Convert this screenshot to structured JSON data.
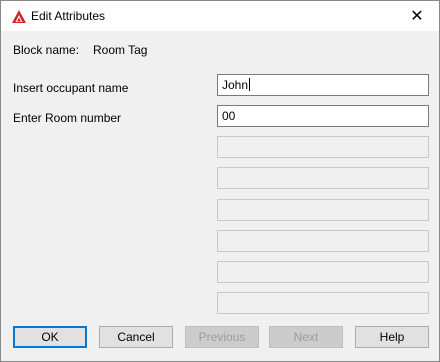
{
  "window": {
    "title": "Edit Attributes"
  },
  "block": {
    "label": "Block name:",
    "value": "Room Tag"
  },
  "attributes": [
    {
      "prompt": "Insert occupant name",
      "value": "John"
    },
    {
      "prompt": "Enter Room number",
      "value": "00"
    }
  ],
  "buttons": {
    "ok": "OK",
    "cancel": "Cancel",
    "previous": "Previous",
    "next": "Next",
    "help": "Help"
  },
  "colors": {
    "accent": "#0078d7",
    "app_icon": "#d2232a"
  }
}
